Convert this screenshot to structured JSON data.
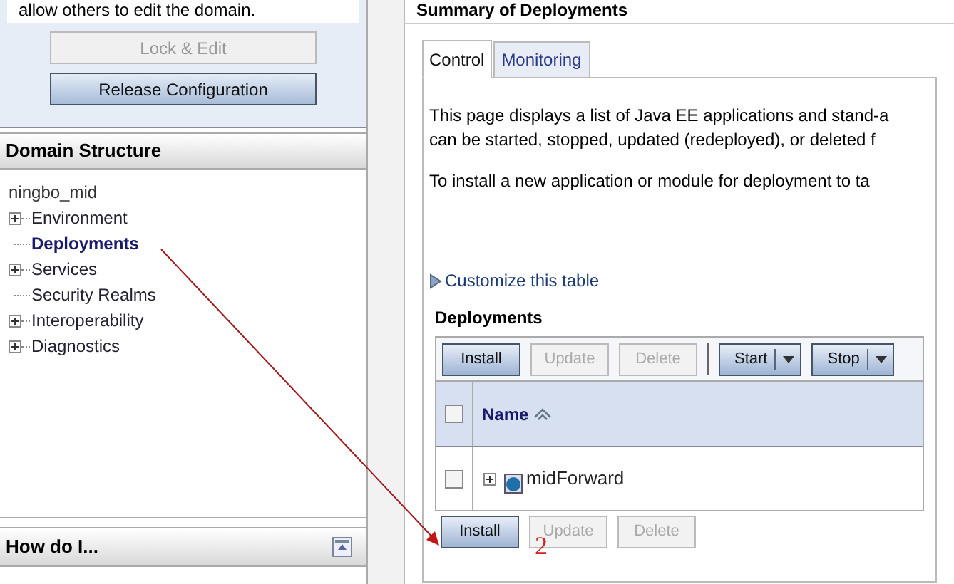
{
  "change_center": {
    "message": "allow others to edit the domain.",
    "buttons": [
      {
        "label": "Lock & Edit",
        "disabled": true
      },
      {
        "label": "Release Configuration",
        "disabled": false
      }
    ]
  },
  "domain_structure": {
    "title": "Domain Structure",
    "root": "ningbo_mid",
    "items": [
      {
        "label": "Environment",
        "expandable": true,
        "selected": false
      },
      {
        "label": "Deployments",
        "expandable": false,
        "selected": true
      },
      {
        "label": "Services",
        "expandable": true,
        "selected": false
      },
      {
        "label": "Security Realms",
        "expandable": false,
        "selected": false
      },
      {
        "label": "Interoperability",
        "expandable": true,
        "selected": false
      },
      {
        "label": "Diagnostics",
        "expandable": true,
        "selected": false
      }
    ]
  },
  "how_do_i": {
    "title": "How do I..."
  },
  "main": {
    "title": "Summary of Deployments",
    "tabs": [
      {
        "label": "Control",
        "selected": true
      },
      {
        "label": "Monitoring",
        "selected": false
      }
    ],
    "paragraphs": [
      "This page displays a list of Java EE applications and stand-a",
      "can be started, stopped, updated (redeployed), or deleted f",
      "To install a new application or module for deployment to ta"
    ],
    "customize_link": "Customize this table",
    "table_title": "Deployments",
    "toolbar_top": [
      {
        "label": "Install",
        "disabled": false,
        "dropdown": false
      },
      {
        "label": "Update",
        "disabled": true,
        "dropdown": false
      },
      {
        "label": "Delete",
        "disabled": true,
        "dropdown": false
      },
      {
        "label": "Start",
        "disabled": false,
        "dropdown": true
      },
      {
        "label": "Stop",
        "disabled": false,
        "dropdown": true
      }
    ],
    "select_all": {
      "checked": false
    },
    "columns": [
      "Name"
    ],
    "rows": [
      {
        "name": "midForward",
        "checked": false
      }
    ],
    "toolbar_bottom": [
      {
        "label": "Install",
        "disabled": false,
        "dropdown": false
      },
      {
        "label": "Update",
        "disabled": true,
        "dropdown": false
      },
      {
        "label": "Delete",
        "disabled": true,
        "dropdown": false
      }
    ]
  },
  "annotation": {
    "step": "2"
  }
}
